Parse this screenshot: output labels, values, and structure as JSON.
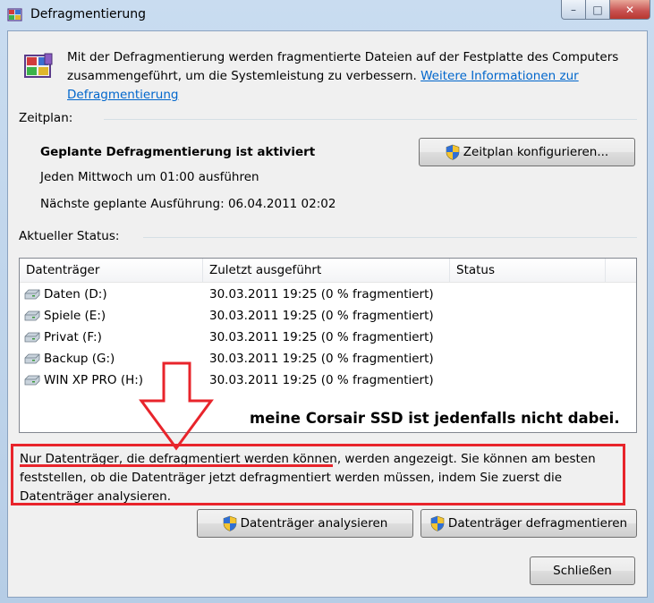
{
  "window": {
    "title": "Defragmentierung",
    "controls": {
      "minimize": "–",
      "maximize": "□",
      "close": "✕"
    }
  },
  "intro": {
    "text": "Mit der Defragmentierung werden fragmentierte Dateien auf der Festplatte des Computers zusammengeführt, um die Systemleistung zu verbessern. ",
    "link": "Weitere Informationen zur Defragmentierung"
  },
  "schedule": {
    "label": "Zeitplan:",
    "status": "Geplante Defragmentierung ist aktiviert",
    "frequency": "Jeden Mittwoch um 01:00 ausführen",
    "next_run": "Nächste geplante Ausführung: 06.04.2011 02:02",
    "configure_button": "Zeitplan konfigurieren..."
  },
  "status_section": {
    "label": "Aktueller Status:",
    "columns": [
      "Datenträger",
      "Zuletzt ausgeführt",
      "Status"
    ],
    "rows": [
      {
        "drive": "Daten (D:)",
        "last_run": "30.03.2011 19:25 (0 % fragmentiert)",
        "status": ""
      },
      {
        "drive": "Spiele (E:)",
        "last_run": "30.03.2011 19:25 (0 % fragmentiert)",
        "status": ""
      },
      {
        "drive": "Privat (F:)",
        "last_run": "30.03.2011 19:25 (0 % fragmentiert)",
        "status": ""
      },
      {
        "drive": "Backup (G:)",
        "last_run": "30.03.2011 19:25 (0 % fragmentiert)",
        "status": ""
      },
      {
        "drive": "WIN XP PRO (H:)",
        "last_run": "30.03.2011 19:25 (0 % fragmentiert)",
        "status": ""
      }
    ]
  },
  "annotation": {
    "text": "meine Corsair SSD ist jedenfalls nicht dabei.",
    "color": "#e8242b"
  },
  "note": {
    "text": "Nur Datenträger, die defragmentiert werden können, werden angezeigt. Sie können am besten feststellen, ob die Datenträger jetzt defragmentiert werden müssen, indem Sie zuerst die Datenträger analysieren."
  },
  "actions": {
    "analyze": "Datenträger analysieren",
    "defragment": "Datenträger defragmentieren",
    "close": "Schließen"
  },
  "icons": {
    "title": "defrag-app-icon",
    "intro": "defrag-app-icon",
    "uac": "uac-shield-icon",
    "drive": "hard-drive-icon"
  }
}
